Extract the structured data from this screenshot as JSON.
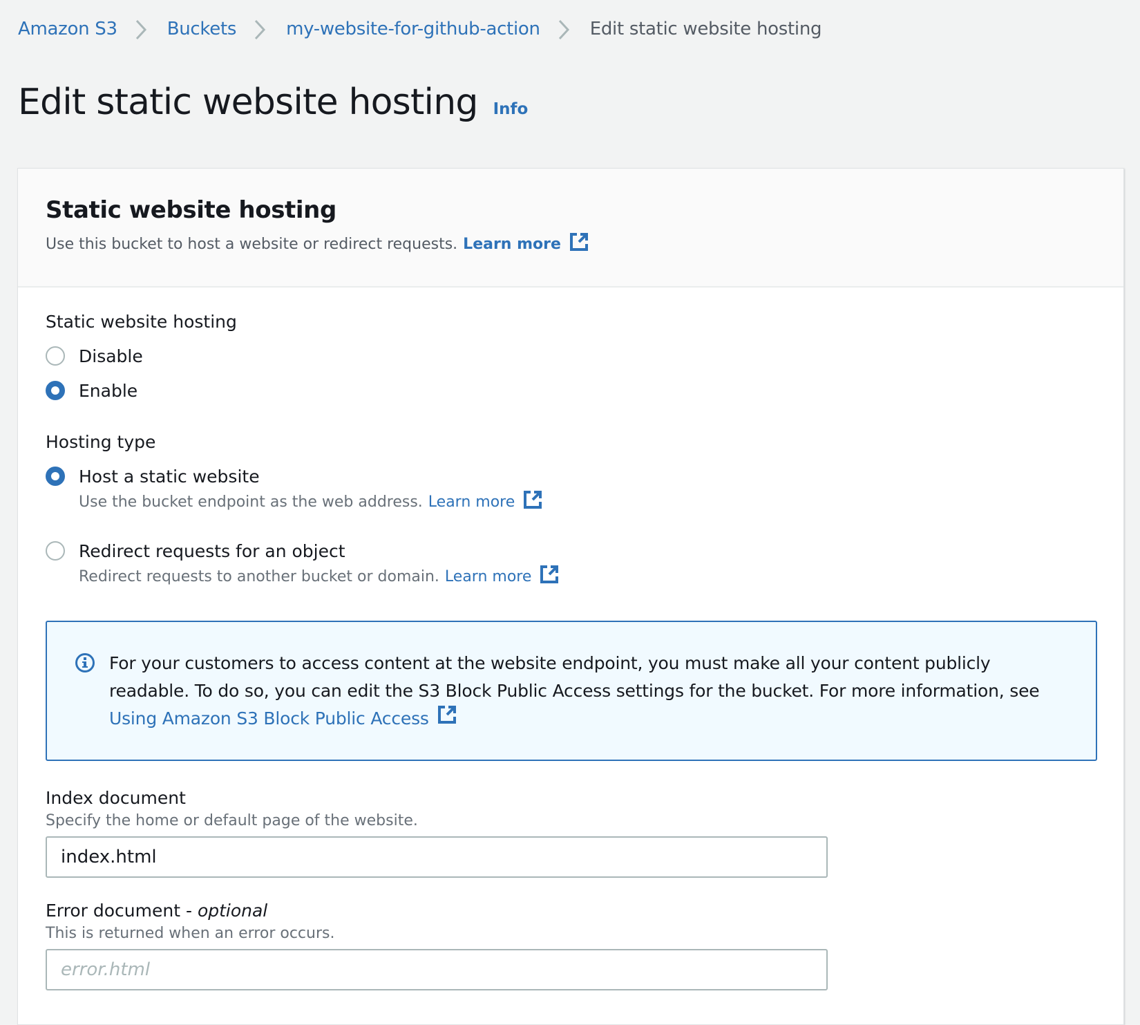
{
  "breadcrumbs": [
    {
      "label": "Amazon S3"
    },
    {
      "label": "Buckets"
    },
    {
      "label": "my-website-for-github-action"
    },
    {
      "label": "Edit static website hosting"
    }
  ],
  "page": {
    "title": "Edit static website hosting",
    "info_label": "Info"
  },
  "container": {
    "title": "Static website hosting",
    "description": "Use this bucket to host a website or redirect requests.",
    "learn_more": "Learn more"
  },
  "hosting_toggle": {
    "label": "Static website hosting",
    "options": [
      {
        "label": "Disable",
        "checked": false
      },
      {
        "label": "Enable",
        "checked": true
      }
    ]
  },
  "hosting_type": {
    "label": "Hosting type",
    "options": [
      {
        "label": "Host a static website",
        "description": "Use the bucket endpoint as the web address.",
        "learn_more": "Learn more",
        "checked": true
      },
      {
        "label": "Redirect requests for an object",
        "description": "Redirect requests to another bucket or domain.",
        "learn_more": "Learn more",
        "checked": false
      }
    ]
  },
  "alert": {
    "icon": "info-icon",
    "text": "For your customers to access content at the website endpoint, you must make all your content publicly readable. To do so, you can edit the S3 Block Public Access settings for the bucket. For more information, see",
    "link_label": "Using Amazon S3 Block Public Access"
  },
  "index_document": {
    "label": "Index document",
    "description": "Specify the home or default page of the website.",
    "value": "index.html",
    "placeholder": ""
  },
  "error_document": {
    "label": "Error document - ",
    "optional_label": "optional",
    "description": "This is returned when an error occurs.",
    "value": "",
    "placeholder": "error.html"
  },
  "colors": {
    "link": "#2e72b8",
    "background": "#f2f3f3",
    "alert_background": "#f1faff",
    "text": "#16191f",
    "muted": "#687078"
  }
}
